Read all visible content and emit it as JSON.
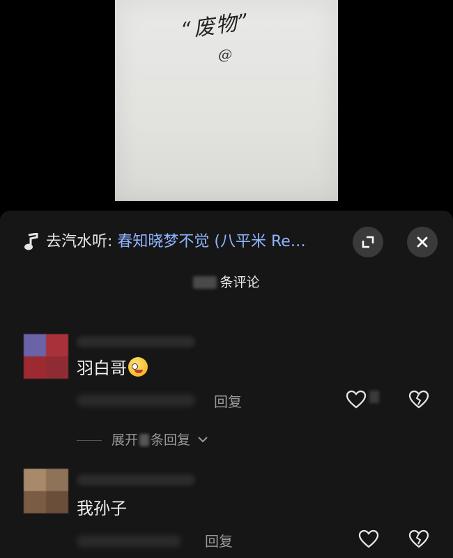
{
  "video": {
    "handwriting": "“废物”",
    "handwriting_at": "@"
  },
  "sheet": {
    "music": {
      "prefix": "去汽水听: ",
      "title": "春知晓梦不觉 (八平米 Re…",
      "icon": "music-note-icon"
    },
    "expand_icon": "expand-icon",
    "close_icon": "close-icon",
    "comment_count_suffix": "条评论",
    "comments": [
      {
        "text": "羽白哥",
        "emoji": "silly-face-emoji",
        "reply_label": "回复",
        "expand_prefix": "展开",
        "expand_suffix": "条回复"
      },
      {
        "text": "我孙子",
        "reply_label": "回复"
      }
    ]
  },
  "colors": {
    "background": "#000000",
    "sheet": "#161616",
    "music_title": "#8fb4ff",
    "secondary_text": "#9a9a9a"
  }
}
